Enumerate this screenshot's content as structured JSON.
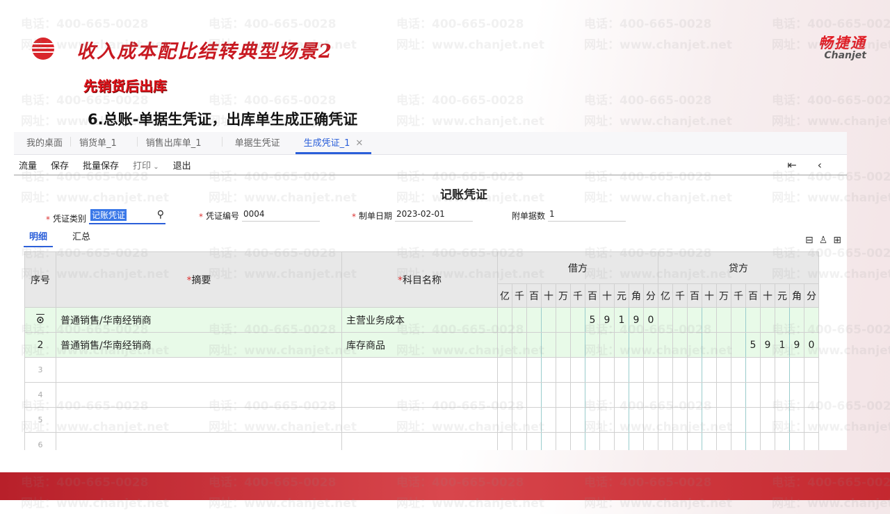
{
  "slide": {
    "title": "收入成本配比结转典型场景2",
    "subtitle": "先销货后出库",
    "step": "6.总账-单据生凭证，出库单生成正确凭证",
    "brand_cn": "畅捷通",
    "brand_en": "Chanjet",
    "watermark_phone": "电话：400-665-0028",
    "watermark_web": "网址：www.chanjet.net"
  },
  "tabs": [
    "我的桌面",
    "销货单_1",
    "销售出库单_1",
    "单据生凭证",
    "生成凭证_1"
  ],
  "toolbar": {
    "items": [
      "流量",
      "保存",
      "批量保存",
      "打印",
      "退出"
    ]
  },
  "voucher": {
    "title": "记账凭证",
    "type_label": "凭证类别",
    "type_value": "记账凭证",
    "no_label": "凭证编号",
    "no_value": "0004",
    "date_label": "制单日期",
    "date_value": "2023-02-01",
    "attach_label": "附单据数",
    "attach_value": "1"
  },
  "subtabs": [
    "明细",
    "汇总"
  ],
  "table": {
    "headers": {
      "no": "序号",
      "summary": "摘要",
      "account": "科目名称",
      "debit": "借方",
      "credit": "贷方"
    },
    "digit_units": [
      "亿",
      "千",
      "百",
      "十",
      "万",
      "千",
      "百",
      "十",
      "元",
      "角",
      "分"
    ],
    "rows": [
      {
        "no": "",
        "summary": "普通销售/华南经销商",
        "account": "主营业务成本",
        "debit": "59190",
        "credit": ""
      },
      {
        "no": "2",
        "summary": "普通销售/华南经销商",
        "account": "库存商品",
        "debit": "",
        "credit": "59190"
      },
      {
        "no": "3",
        "summary": "",
        "account": "",
        "debit": "",
        "credit": ""
      },
      {
        "no": "4",
        "summary": "",
        "account": "",
        "debit": "",
        "credit": ""
      },
      {
        "no": "5",
        "summary": "",
        "account": "",
        "debit": "",
        "credit": ""
      },
      {
        "no": "6",
        "summary": "",
        "account": "",
        "debit": "",
        "credit": ""
      }
    ]
  },
  "colors": {
    "accent": "#2b5fd9",
    "brand_red": "#d9252b",
    "row_green": "#e8fae8"
  }
}
